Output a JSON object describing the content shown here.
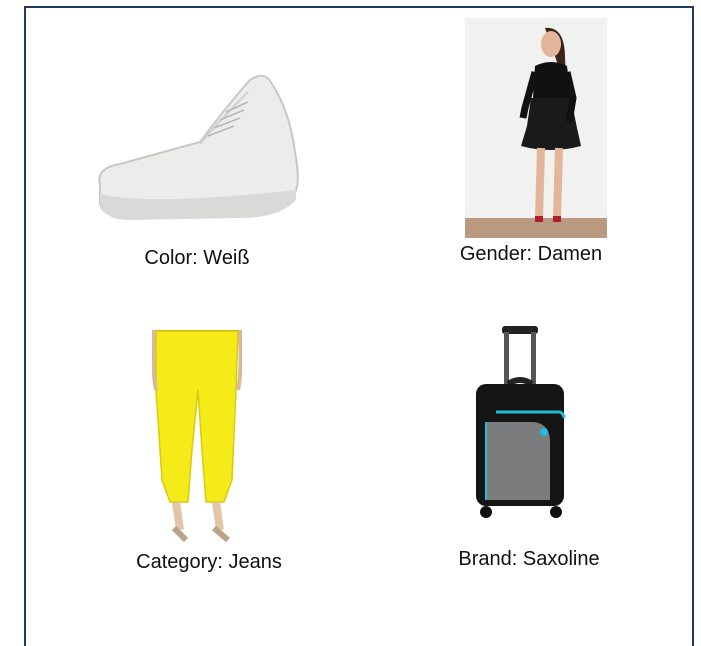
{
  "items": [
    {
      "caption": "Color: Weiß",
      "icon": "white-sneaker"
    },
    {
      "caption": "Gender: Damen",
      "icon": "woman-in-black-dress"
    },
    {
      "caption": "Category: Jeans",
      "icon": "yellow-jeans"
    },
    {
      "caption": "Brand: Saxoline",
      "icon": "black-suitcase"
    }
  ]
}
